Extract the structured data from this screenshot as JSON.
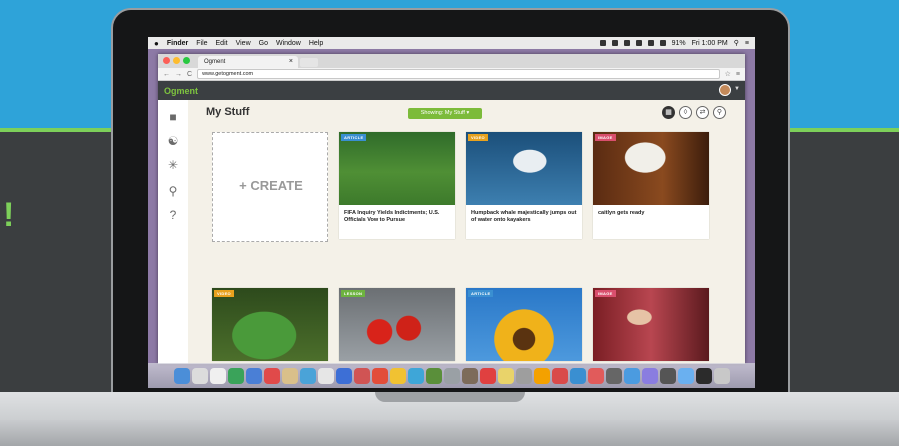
{
  "menubar": {
    "apple": "",
    "app_name": "Finder",
    "items": [
      "File",
      "Edit",
      "View",
      "Go",
      "Window",
      "Help"
    ],
    "battery": "91%",
    "clock": "Fri 1:00 PM"
  },
  "browser": {
    "tab_title": "Ogment",
    "tab_close": "×",
    "url": "www.getogment.com",
    "nav": {
      "back": "←",
      "forward": "→",
      "reload": "C"
    }
  },
  "app": {
    "logo": "Ogment",
    "page_title": "My Stuff",
    "filter_label": "Showing: My Stuff",
    "create_label": "+ CREATE",
    "cards": [
      {
        "badge": "ARTICLE",
        "badge_color": "#3a8fd1",
        "caption": "FIFA Inquiry Yields Indictments; U.S. Officials Vow to Pursue",
        "img": "soccer"
      },
      {
        "badge": "VIDEO",
        "badge_color": "#e8a21e",
        "caption": "Humpback whale majestically jumps out of water onto kayakers",
        "img": "whale"
      },
      {
        "badge": "IMAGE",
        "badge_color": "#d94f6d",
        "caption": "caitlyn gets ready",
        "img": "horse"
      },
      {
        "badge": "VIDEO",
        "badge_color": "#e8a21e",
        "caption": "",
        "img": "frog"
      },
      {
        "badge": "LESSON",
        "badge_color": "#6db33f",
        "caption": "",
        "img": "tomato"
      },
      {
        "badge": "ARTICLE",
        "badge_color": "#3a8fd1",
        "caption": "",
        "img": "sunflower"
      },
      {
        "badge": "IMAGE",
        "badge_color": "#d94f6d",
        "caption": "",
        "img": "clinton"
      }
    ]
  },
  "colors": {
    "accent": "#7cbb3a",
    "header": "#3b3f42",
    "bg_top": "#2ea3d9"
  }
}
